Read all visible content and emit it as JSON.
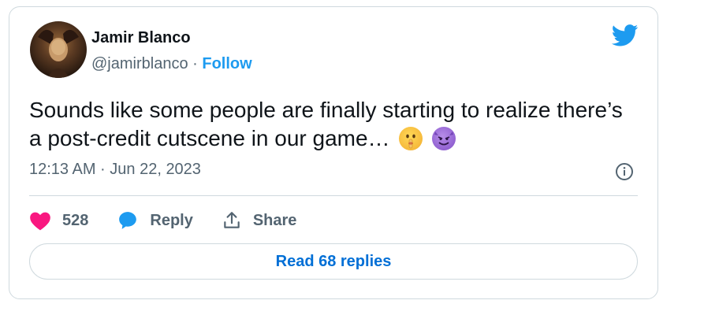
{
  "user": {
    "name": "Jamir Blanco",
    "handle": "@jamirblanco",
    "separator": "·",
    "follow_label": "Follow"
  },
  "tweet": {
    "text": "Sounds like some people are finally starting to realize there’s a post-credit cutscene in our game…",
    "emojis": [
      "shushing-face",
      "smiling-face-with-horns"
    ],
    "timestamp": "12:13 AM · Jun 22, 2023"
  },
  "actions": {
    "like_count": "528",
    "reply_label": "Reply",
    "share_label": "Share"
  },
  "read_replies_label": "Read 68 replies",
  "icons": [
    "twitter-bird-icon",
    "info-icon",
    "heart-icon",
    "reply-bubble-icon",
    "share-icon"
  ],
  "colors": {
    "brand_blue": "#1d9bf0",
    "link_blue": "#006fd6",
    "heart_pink": "#f91880",
    "text_primary": "#0f1419",
    "text_secondary": "#536471",
    "border": "#cfd9de"
  }
}
